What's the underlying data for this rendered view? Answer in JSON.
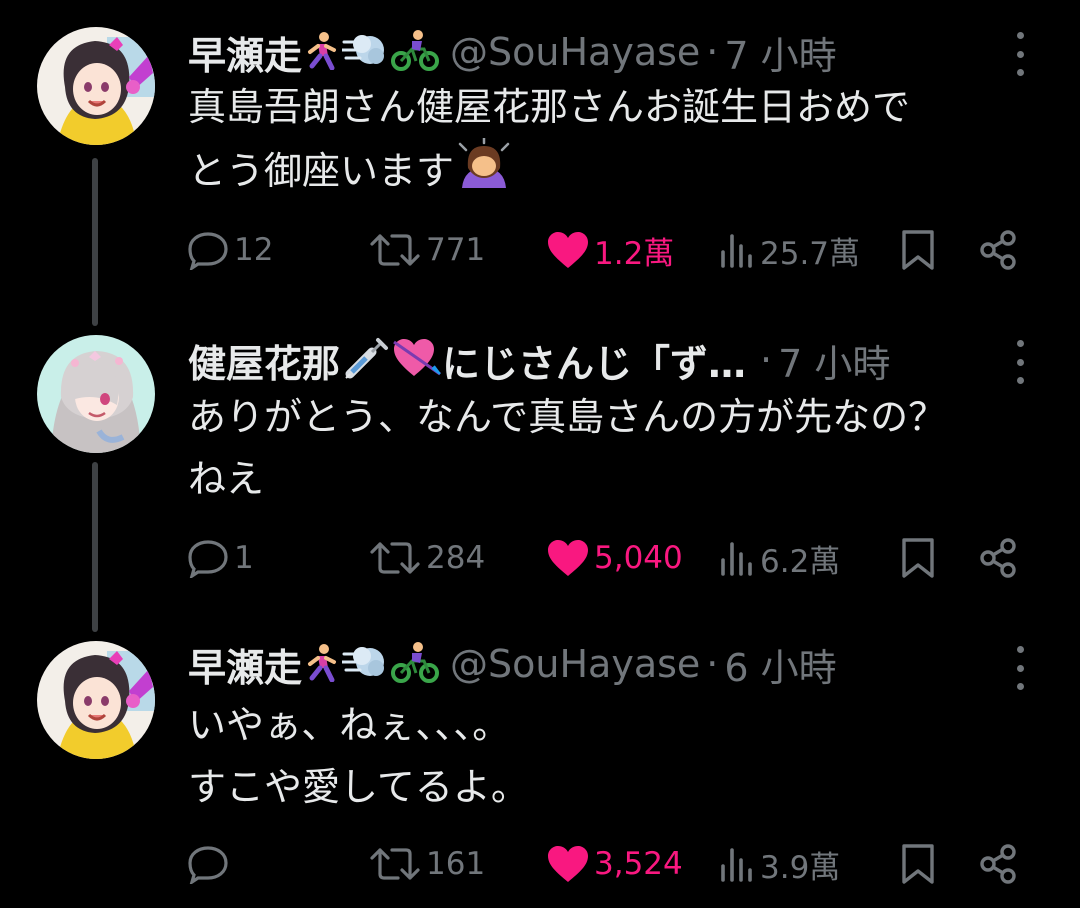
{
  "tweets": [
    {
      "name": "早瀬走",
      "name_emoji": [
        "runner-emoji",
        "dash-emoji",
        "cyclist-emoji"
      ],
      "handle": "@SouHayase",
      "separator": "·",
      "time": "7 小時",
      "text_lines": [
        "真島吾朗さん健屋花那さんお誕生日おめで",
        "とう御座います"
      ],
      "text_emoji": "bowing-person-emoji",
      "replies": "12",
      "retweets": "771",
      "likes": "1.2萬",
      "views": "25.7萬",
      "liked": true
    },
    {
      "name": "健屋花那",
      "name_emoji": [
        "syringe-emoji",
        "heart-with-arrow-emoji"
      ],
      "name_suffix": "にじさんじ「ず…",
      "separator": "·",
      "time": "7 小時",
      "text_lines": [
        "ありがとう、なんで真島さんの方が先なの？",
        "ねえ"
      ],
      "replies": "1",
      "retweets": "284",
      "likes": "5,040",
      "views": "6.2萬",
      "liked": true
    },
    {
      "name": "早瀬走",
      "name_emoji": [
        "runner-emoji",
        "dash-emoji",
        "cyclist-emoji"
      ],
      "handle": "@SouHayase",
      "separator": "·",
      "time": "6 小時",
      "text_lines": [
        "いやぁ、ねぇ、、、。",
        "すこや愛してるよ。"
      ],
      "replies": "",
      "retweets": "161",
      "likes": "3,524",
      "views": "3.9萬",
      "liked": true
    }
  ],
  "colors": {
    "background": "#000000",
    "text_primary": "#e7e9ea",
    "text_secondary": "#71767b",
    "like_pink": "#f91880",
    "thread_line": "#3e4144"
  }
}
